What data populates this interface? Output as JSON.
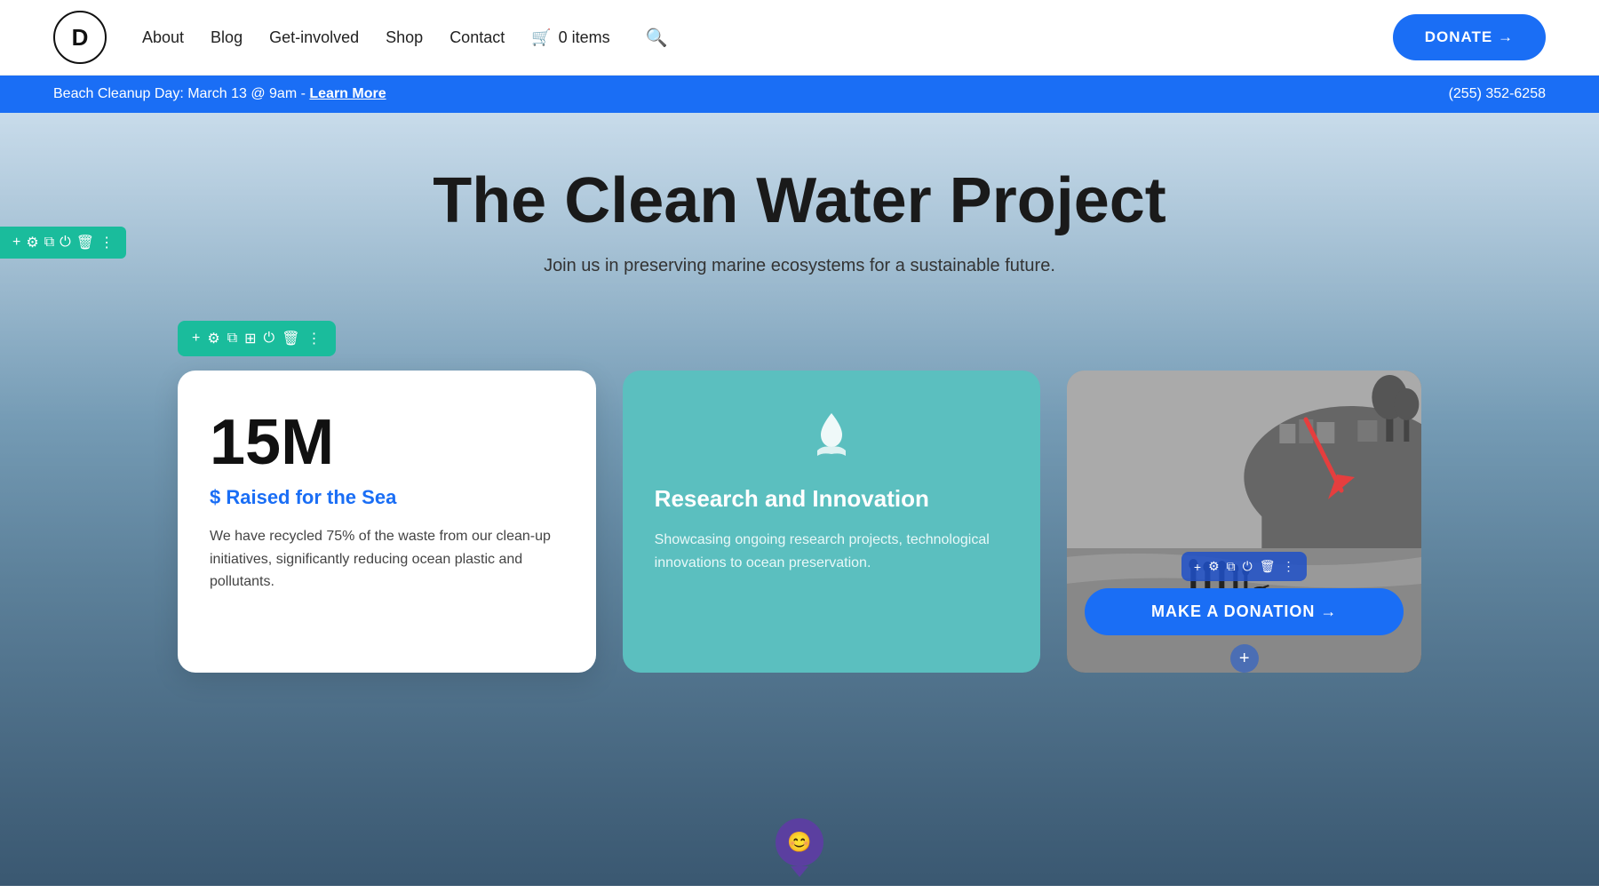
{
  "header": {
    "logo_letter": "D",
    "nav_items": [
      {
        "label": "About",
        "id": "about"
      },
      {
        "label": "Blog",
        "id": "blog"
      },
      {
        "label": "Get-involved",
        "id": "get-involved"
      },
      {
        "label": "Shop",
        "id": "shop"
      },
      {
        "label": "Contact",
        "id": "contact"
      }
    ],
    "cart_label": "0 items",
    "donate_label": "DONATE →"
  },
  "announcement": {
    "text": "Beach Cleanup Day: March 13 @ 9am - ",
    "link_text": "Learn More",
    "phone": "(255) 352-6258"
  },
  "hero": {
    "title": "The Clean Water Project",
    "subtitle": "Join us in preserving marine ecosystems for a sustainable future."
  },
  "cards": [
    {
      "id": "stat-card",
      "number": "15M",
      "subtitle": "$ Raised for the Sea",
      "description": "We have recycled 75% of the waste from our clean-up initiatives, significantly reducing ocean plastic and pollutants."
    },
    {
      "id": "innovation-card",
      "icon": "💧",
      "title": "Research and Innovation",
      "description": "Showcasing ongoing research projects, technological innovations to ocean preservation."
    },
    {
      "id": "photo-card",
      "donation_btn": "MAKE A DONATION →"
    }
  ],
  "editor_tools": {
    "icons": [
      "+",
      "⚙",
      "⧉",
      "⊞",
      "⏻",
      "🗑",
      "⋮"
    ]
  },
  "section_tools": {
    "icons": [
      "+",
      "⚙",
      "⧉",
      "⊞",
      "⏻",
      "🗑",
      "⋮"
    ]
  },
  "photo_card_tools": {
    "icons": [
      "+",
      "⚙",
      "⧉",
      "⏻",
      "🗑",
      "⋮"
    ]
  }
}
